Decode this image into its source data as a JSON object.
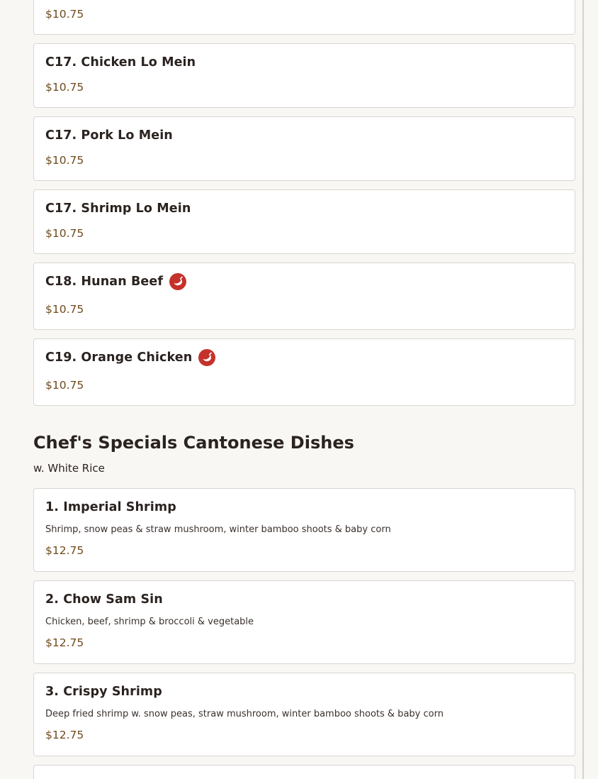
{
  "colors": {
    "price": "#6e4a1c",
    "spicy_badge": "#c5322b",
    "card_border": "#d9d6d2",
    "page_bg": "#f8f7f3"
  },
  "items_top": [
    {
      "name": "",
      "price": "$10.75"
    },
    {
      "name": "C17. Chicken Lo Mein",
      "price": "$10.75"
    },
    {
      "name": "C17. Pork Lo Mein",
      "price": "$10.75"
    },
    {
      "name": "C17. Shrimp Lo Mein",
      "price": "$10.75"
    },
    {
      "name": "C18. Hunan Beef",
      "price": "$10.75",
      "spicy": true,
      "icon": "chili-pepper-icon"
    },
    {
      "name": "C19. Orange Chicken",
      "price": "$10.75",
      "spicy": true,
      "icon": "chili-pepper-icon"
    }
  ],
  "section": {
    "title": "Chef's Specials Cantonese Dishes",
    "subtitle": "w. White Rice",
    "items": [
      {
        "name": "1. Imperial Shrimp",
        "description": "Shrimp, snow peas & straw mushroom, winter bamboo shoots & baby corn",
        "price": "$12.75"
      },
      {
        "name": "2. Chow Sam Sin",
        "description": "Chicken, beef, shrimp & broccoli & vegetable",
        "price": "$12.75"
      },
      {
        "name": "3. Crispy Shrimp",
        "description": "Deep fried shrimp w. snow peas, straw mushroom, winter bamboo shoots & baby corn",
        "price": "$12.75"
      }
    ]
  }
}
